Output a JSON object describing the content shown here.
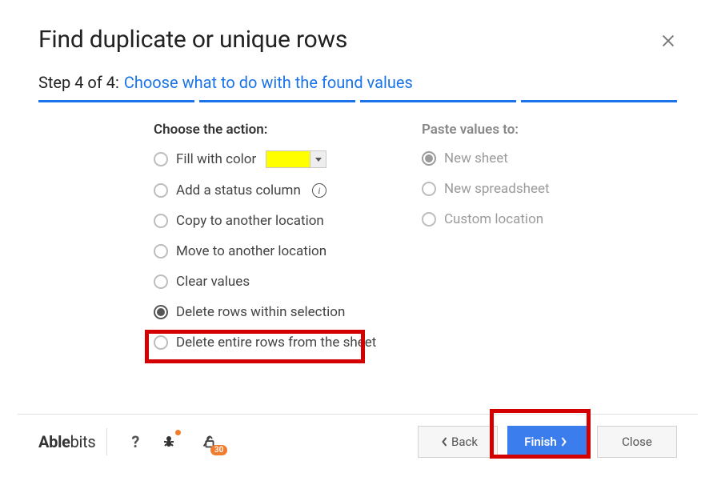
{
  "title": "Find duplicate or unique rows",
  "step": {
    "label": "Step 4 of 4:",
    "desc": "Choose what to do with the found values"
  },
  "left": {
    "heading": "Choose the action:",
    "options": [
      "Fill with color",
      "Add a status column",
      "Copy to another location",
      "Move to another location",
      "Clear values",
      "Delete rows within selection",
      "Delete entire rows from the sheet"
    ],
    "selectedIndex": 5,
    "fillColor": "#ffff00"
  },
  "right": {
    "heading": "Paste values to:",
    "options": [
      "New sheet",
      "New spreadsheet",
      "Custom location"
    ],
    "selectedIndex": 0
  },
  "footer": {
    "brand": "Ablebits",
    "trialDays": "30",
    "back": "Back",
    "finish": "Finish",
    "close": "Close"
  }
}
